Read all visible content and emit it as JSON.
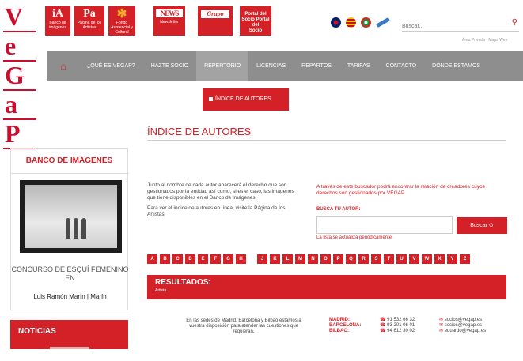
{
  "logo": {
    "letters": [
      "V",
      "e",
      "G",
      "a",
      "P"
    ]
  },
  "top_buttons": [
    {
      "label": "Banco de imágenes",
      "icon": "iA"
    },
    {
      "label": "Página de los Artistas",
      "icon": "Pa"
    },
    {
      "label": "Fondo Asistencial y Cultural",
      "icon": "✻"
    },
    {
      "label": "Newsletter",
      "icon": "NEWS"
    },
    {
      "label": "",
      "icon": "Grupo"
    },
    {
      "label": "Portal del Socio",
      "icon": ""
    }
  ],
  "flags": [
    "uk-flag-icon",
    "catalan-flag-icon",
    "basque-flag-icon",
    "galician-flag-icon"
  ],
  "search": {
    "placeholder": "Buscar...",
    "icon": "search-icon"
  },
  "top_links": "Área Privada · Mapa Web",
  "nav": {
    "items": [
      "¿QUÉ ES VEGAP?",
      "HAZTE SOCIO",
      "REPERTORIO",
      "LICENCIAS",
      "REPARTOS",
      "TARIFAS",
      "CONTACTO",
      "DÓNDE ESTAMOS"
    ],
    "active": "REPERTORIO",
    "home_icon": "home-icon"
  },
  "submenu": {
    "label": "ÍNDICE DE AUTORES"
  },
  "sidebar": {
    "banco_title": "BANCO DE IMÁGENES",
    "caption": "CONCURSO DE ESQUÍ FEMENINO EN",
    "author": "Luis Ramón Marín | Marín",
    "noticias": "NOTICIAS"
  },
  "main": {
    "title": "ÍNDICE DE AUTORES",
    "intro_p1": "Junto al nombre de cada autor aparecerá el derecho que son gestionados por la entidad así como, si es el caso, las imágenes que tiene disponibles en el Banco de Imágenes.",
    "intro_p2": "Para ver el índice de autores en línea, visite la Página de los Artistas",
    "right_intro": "A través de este buscador podrá encontrar la relación de creadores cuyos derechos son gestionados por VEGAP",
    "busca_label": "BUSCA TU AUTOR:",
    "busca_button": "Buscar ⊙",
    "busca_note": "La lista se actualiza periódicamente.",
    "letters": [
      "A",
      "B",
      "C",
      "D",
      "E",
      "F",
      "G",
      "H",
      "",
      "J",
      "K",
      "L",
      "M",
      "N",
      "O",
      "P",
      "Q",
      "R",
      "S",
      "T",
      "U",
      "V",
      "W",
      "X",
      "Y",
      "Z"
    ],
    "results_title": "RESULTADOS:",
    "results_sub": "Artista"
  },
  "footer": {
    "text": "En las sedes de Madrid, Barcelona y Bilbao estamos a vuestra disposición para atender las cuestiones que requieran.",
    "cities": [
      "MADRID:",
      "BARCELONA:",
      "BILBAO:"
    ],
    "phones": [
      "91 532 66 32",
      "93 201 06 01",
      "94 612 30 02"
    ],
    "emails": [
      "socios@vegap.es",
      "socios@vegap.es",
      "eduardo@vegap.es"
    ]
  }
}
